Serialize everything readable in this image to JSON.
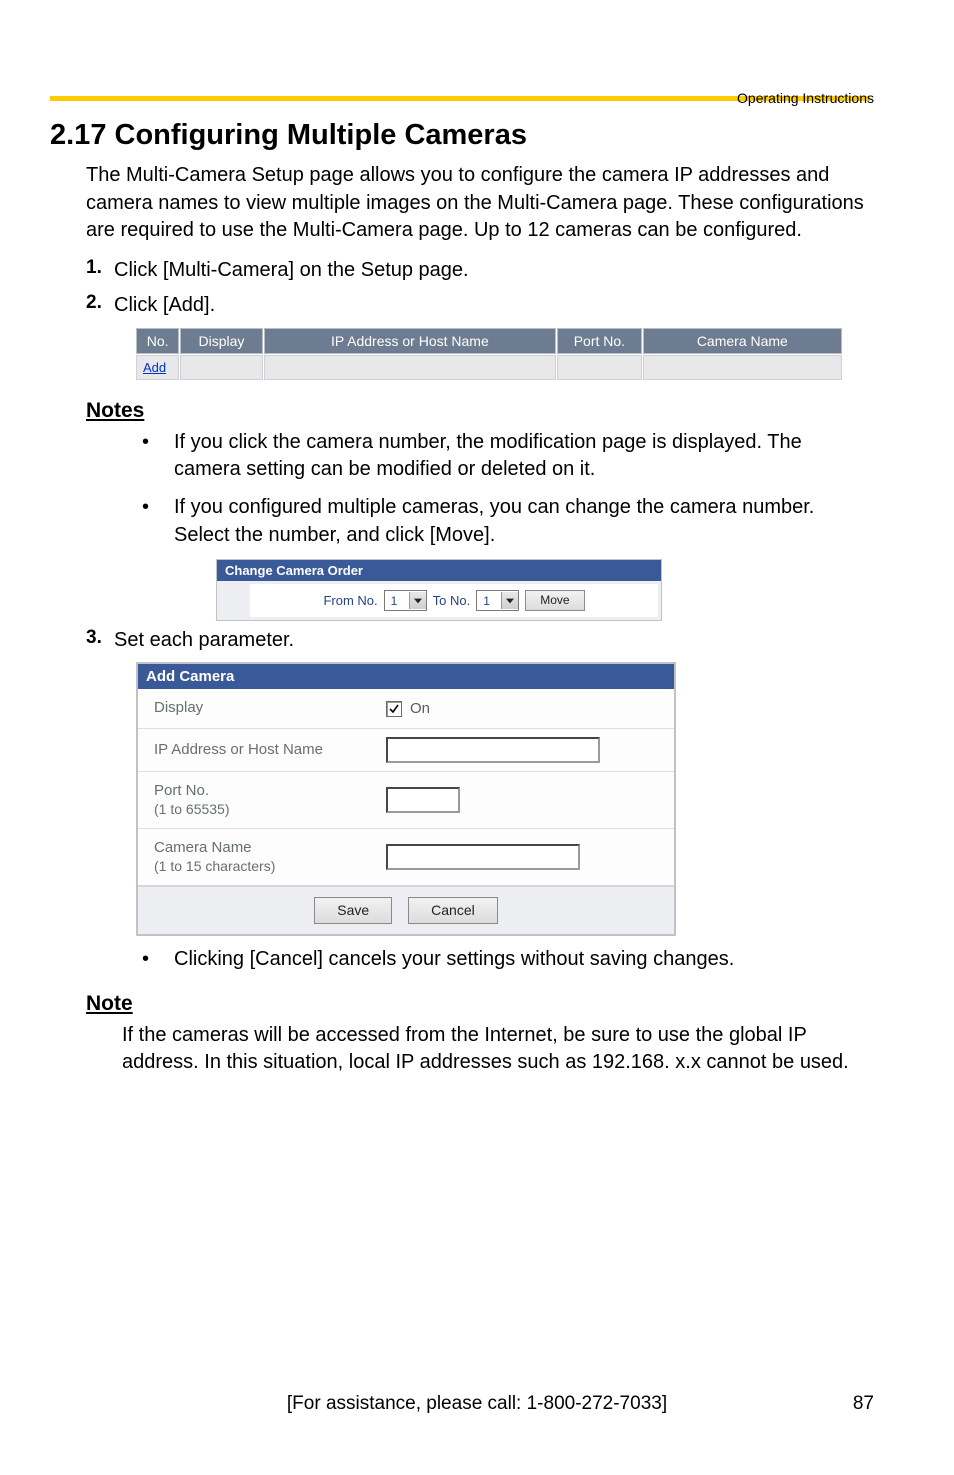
{
  "header": {
    "title": "Operating Instructions"
  },
  "section": {
    "number": "2.17",
    "heading": "2.17  Configuring Multiple Cameras",
    "intro": "The Multi-Camera Setup page allows you to configure the camera IP addresses and camera names to view multiple images on the Multi-Camera page. These configurations are required to use the Multi-Camera page. Up to 12 cameras can be configured."
  },
  "steps": [
    {
      "num": "1.",
      "text": "Click [Multi-Camera] on the Setup page."
    },
    {
      "num": "2.",
      "text": "Click [Add]."
    },
    {
      "num": "3.",
      "text": "Set each parameter."
    }
  ],
  "camera_table": {
    "headers": [
      "No.",
      "Display",
      "IP Address or Host Name",
      "Port No.",
      "Camera Name"
    ],
    "add_label": "Add"
  },
  "notes_heading": "Notes",
  "notes": [
    "If you click the camera number, the modification page is displayed. The camera setting can be modified or deleted on it.",
    "If you configured multiple cameras, you can change the camera number. Select the number, and click [Move]."
  ],
  "order_panel": {
    "title": "Change Camera Order",
    "from_label": "From No.",
    "from_value": "1",
    "to_label": "To No.",
    "to_value": "1",
    "move_label": "Move"
  },
  "add_panel": {
    "title": "Add Camera",
    "rows": {
      "display_label": "Display",
      "display_value_label": "On",
      "display_checked": true,
      "ip_label": "IP Address or Host Name",
      "port_label": "Port No.",
      "port_sub": "(1 to 65535)",
      "name_label": "Camera Name",
      "name_sub": "(1 to 15 characters)"
    },
    "save_label": "Save",
    "cancel_label": "Cancel"
  },
  "cancel_note": "Clicking [Cancel] cancels your settings without saving changes.",
  "note_heading": "Note",
  "note_body": "If the cameras will be accessed from the Internet, be sure to use the global IP address. In this situation, local IP addresses such as 192.168. x.x cannot be used.",
  "footer": {
    "assist": "[For assistance, please call: 1-800-272-7033]",
    "page": "87"
  }
}
